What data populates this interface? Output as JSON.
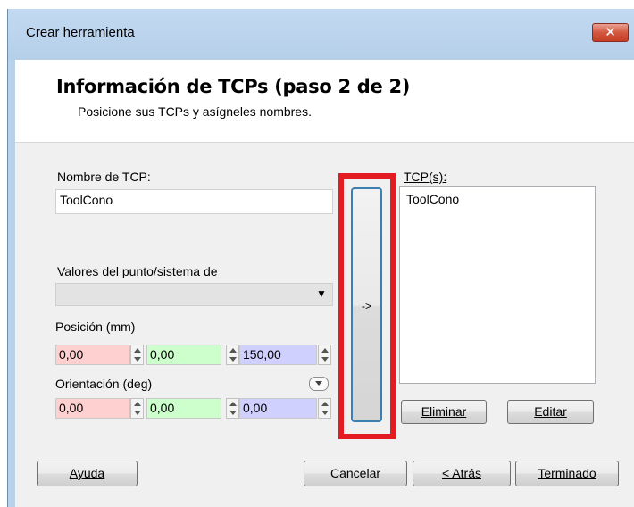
{
  "window": {
    "title": "Crear herramienta",
    "close_symbol": "✕"
  },
  "header": {
    "title": "Información de TCPs (paso 2 de 2)",
    "subtitle": "Posicione sus TCPs y asígneles nombres."
  },
  "form": {
    "tcp_name_label": "Nombre de TCP:",
    "tcp_name_value": "ToolCono",
    "values_label": "Valores del punto/sistema de",
    "values_selected": "",
    "position_label": "Posición (mm)",
    "position": {
      "x": "0,00",
      "y": "0,00",
      "z": "150,00"
    },
    "orientation_label": "Orientación (deg)",
    "orientation": {
      "x": "0,00",
      "y": "0,00",
      "z": "0,00"
    }
  },
  "transfer_button": {
    "label": "->"
  },
  "tcp_list": {
    "label": "TCP(s):",
    "items": [
      "ToolCono"
    ]
  },
  "list_buttons": {
    "delete": "Eliminar",
    "edit": "Editar"
  },
  "footer": {
    "help": "Ayuda",
    "cancel": "Cancelar",
    "back": "< Atrás",
    "finish": "Terminado"
  },
  "colors": {
    "highlight": "#e31b23",
    "x_field": "#ffd0d0",
    "y_field": "#ccffcc",
    "z_field": "#d0d0ff"
  }
}
